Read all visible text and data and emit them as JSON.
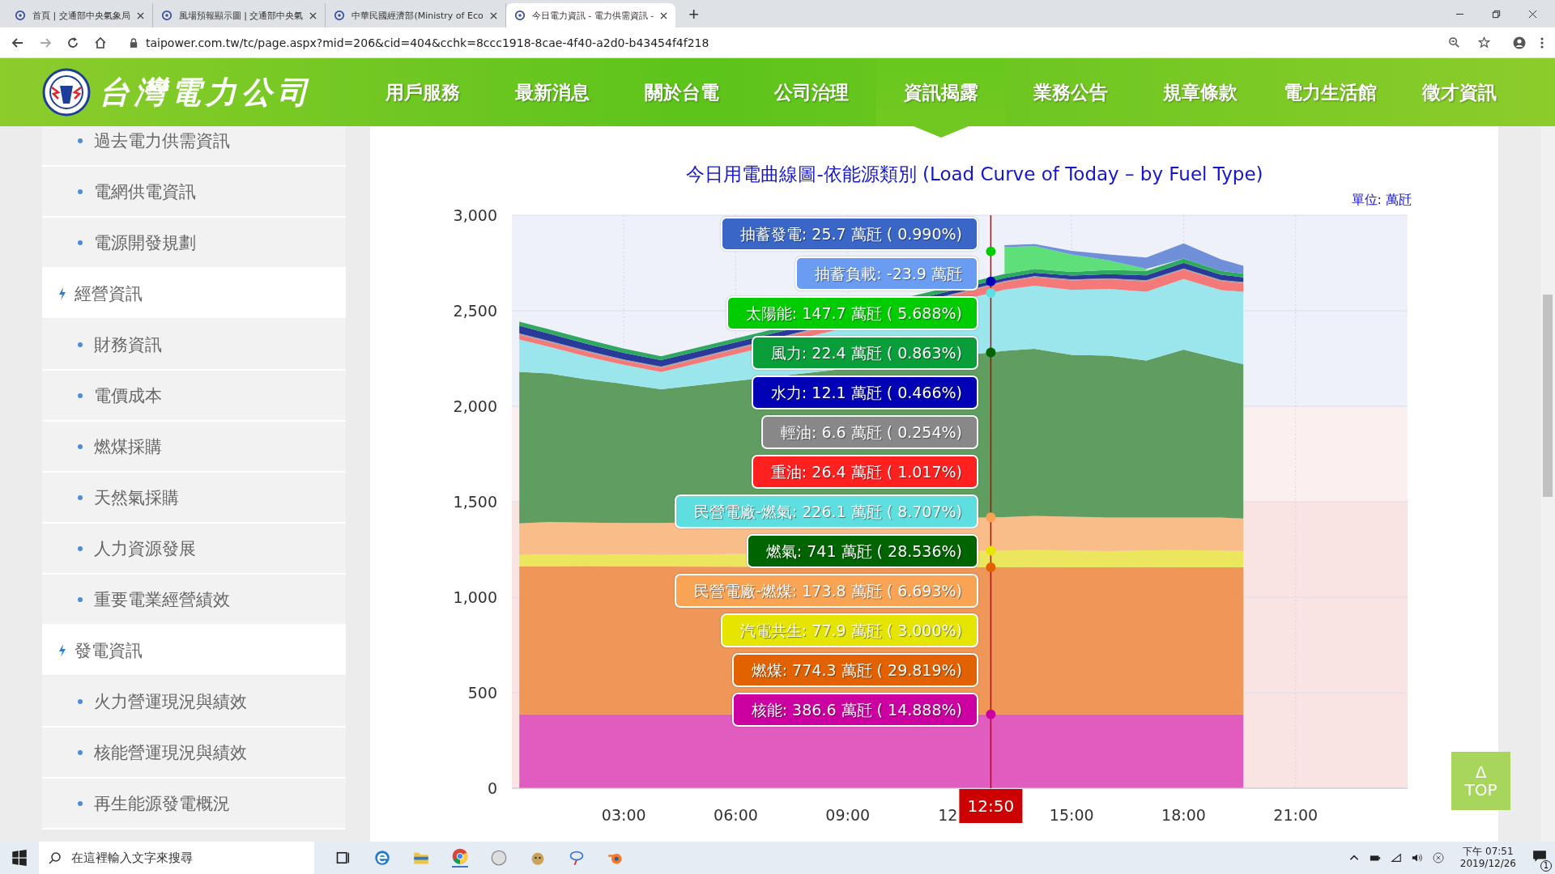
{
  "browser": {
    "tabs": [
      {
        "title": "首頁 | 交通部中央氣象局",
        "selected": false
      },
      {
        "title": "風場預報顯示圖 | 交通部中央氣",
        "selected": false
      },
      {
        "title": "中華民國經濟部(Ministry of Eco",
        "selected": false
      },
      {
        "title": "今日電力資訊 - 電力供需資訊 -",
        "selected": true
      }
    ],
    "new_tab": "+",
    "url": "taipower.com.tw/tc/page.aspx?mid=206&cid=404&cchk=8ccc1918-8cae-4f40-a2d0-b43454f4f218"
  },
  "header": {
    "logo_text": "台灣電力公司",
    "nav": [
      {
        "label": "用戶服務",
        "selected": false
      },
      {
        "label": "最新消息",
        "selected": false
      },
      {
        "label": "關於台電",
        "selected": false
      },
      {
        "label": "公司治理",
        "selected": false
      },
      {
        "label": "資訊揭露",
        "selected": true
      },
      {
        "label": "業務公告",
        "selected": false
      },
      {
        "label": "規章條款",
        "selected": false
      },
      {
        "label": "電力生活館",
        "selected": false
      },
      {
        "label": "徵才資訊",
        "selected": false
      }
    ]
  },
  "sidebar": {
    "items": [
      {
        "label": "過去電力供需資訊",
        "kind": "link"
      },
      {
        "label": "電網供電資訊",
        "kind": "link"
      },
      {
        "label": "電源開發規劃",
        "kind": "link"
      },
      {
        "label": "經營資訊",
        "kind": "section"
      },
      {
        "label": "財務資訊",
        "kind": "link"
      },
      {
        "label": "電價成本",
        "kind": "link"
      },
      {
        "label": "燃煤採購",
        "kind": "link"
      },
      {
        "label": "天然氣採購",
        "kind": "link"
      },
      {
        "label": "人力資源發展",
        "kind": "link"
      },
      {
        "label": "重要電業經營績效",
        "kind": "link"
      },
      {
        "label": "發電資訊",
        "kind": "section"
      },
      {
        "label": "火力營運現況與績效",
        "kind": "link"
      },
      {
        "label": "核能營運現況與績效",
        "kind": "link"
      },
      {
        "label": "再生能源發電概況",
        "kind": "link"
      }
    ]
  },
  "main": {
    "unit": "單位: 萬瓩",
    "chart_data": {
      "type": "area",
      "stacked": true,
      "grid": true,
      "title": "今日用電曲線圖-依能源類別 (Load Curve of Today – by Fuel Type)",
      "x": [
        0.2,
        1,
        2,
        3,
        4,
        13.2,
        14,
        15,
        16,
        17,
        18,
        19,
        19.6
      ],
      "xlim": [
        0,
        24
      ],
      "ylim": [
        0,
        3000
      ],
      "xticks": [
        {
          "value": 3,
          "label": "03:00"
        },
        {
          "value": 6,
          "label": "06:00"
        },
        {
          "value": 9,
          "label": "09:00"
        },
        {
          "value": 15,
          "label": "15:00"
        },
        {
          "value": 18,
          "label": "18:00"
        },
        {
          "value": 21,
          "label": "21:00"
        }
      ],
      "yticks": [
        {
          "value": 0,
          "label": "0"
        },
        {
          "value": 500,
          "label": "500"
        },
        {
          "value": 1000,
          "label": "1,000"
        },
        {
          "value": 1500,
          "label": "1,500"
        },
        {
          "value": 2000,
          "label": "2,000"
        },
        {
          "value": 2500,
          "label": "2,500"
        },
        {
          "value": 3000,
          "label": "3,000"
        }
      ],
      "bands": [
        {
          "axis": "y",
          "from": 2000,
          "to": 3000,
          "color": "#eef0fa"
        },
        {
          "axis": "y",
          "from": 1500,
          "to": 2000,
          "color": "#fcefef"
        },
        {
          "axis": "y",
          "from": 0,
          "to": 1500,
          "color": "#f9e3e3"
        }
      ],
      "ref_lines": [
        {
          "axis": "x",
          "value": 12.8333,
          "color": "#cc0000"
        }
      ],
      "series": [
        {
          "name": "核能",
          "color": "#e05cbf",
          "values": [
            387,
            387,
            387,
            387,
            387,
            387,
            387,
            387,
            387,
            387,
            387,
            387,
            387
          ]
        },
        {
          "name": "燃煤",
          "color": "#ef9659",
          "values": [
            775,
            775,
            776,
            775,
            774,
            770,
            771,
            770,
            770,
            771,
            770,
            770,
            770
          ]
        },
        {
          "name": "汽電共生",
          "color": "#ece55e",
          "values": [
            60,
            62,
            60,
            62,
            60,
            88,
            90,
            88,
            85,
            88,
            90,
            88,
            85
          ]
        },
        {
          "name": "民營電廠-燃煤",
          "color": "#f9bd8a",
          "values": [
            165,
            170,
            168,
            165,
            168,
            175,
            178,
            176,
            175,
            172,
            170,
            172,
            170
          ]
        },
        {
          "name": "燃氣",
          "color": "#5f9e60",
          "values": [
            793,
            778,
            750,
            728,
            700,
            870,
            875,
            848,
            848,
            821,
            879,
            831,
            808
          ]
        },
        {
          "name": "民營電廠-燃氣",
          "color": "#9be6ec",
          "values": [
            170,
            140,
            120,
            100,
            90,
            320,
            330,
            340,
            350,
            360,
            370,
            360,
            380
          ]
        },
        {
          "name": "重油",
          "color": "#f47a7a",
          "values": [
            25,
            24,
            24,
            22,
            22,
            40,
            45,
            50,
            50,
            55,
            50,
            48,
            45
          ]
        },
        {
          "name": "輕油",
          "color": "#a0a0a0",
          "values": [
            6,
            6,
            6,
            6,
            6,
            6,
            5,
            5,
            5,
            6,
            5,
            5,
            5
          ]
        },
        {
          "name": "水力",
          "color": "#2a3a9a",
          "values": [
            40,
            38,
            36,
            35,
            35,
            15,
            18,
            20,
            22,
            25,
            30,
            28,
            25
          ]
        },
        {
          "name": "風力",
          "color": "#2fa860",
          "values": [
            22,
            22,
            24,
            22,
            20,
            22,
            20,
            20,
            22,
            24,
            22,
            20,
            20
          ]
        },
        {
          "name": "太陽能",
          "color": "#5fdf7a",
          "values": [
            null,
            null,
            null,
            null,
            null,
            140,
            120,
            90,
            50,
            10,
            null,
            null,
            null
          ]
        },
        {
          "name": "抽蓄發電",
          "color": "#6f8fd8",
          "values": [
            null,
            null,
            null,
            null,
            null,
            10,
            10,
            20,
            30,
            60,
            80,
            60,
            40
          ]
        }
      ]
    },
    "cursor_time": "12:50",
    "covered_tick_text": "12",
    "tooltip": {
      "items": [
        {
          "kind": "series",
          "reading": ": 25.7 萬瓩 ( 0.990%)",
          "color": "#3a66c8"
        },
        {
          "kind": "extra",
          "label": "抽蓄負載",
          "reading": ": -23.9 萬瓩",
          "color": "#6a9cf2"
        },
        {
          "kind": "series",
          "reading": ": 147.7 萬瓩 ( 5.688%)",
          "color": "#00cc00"
        },
        {
          "kind": "series",
          "reading": ": 22.4 萬瓩 ( 0.863%)",
          "color": "#0a9e3a"
        },
        {
          "kind": "series",
          "reading": ": 12.1 萬瓩 ( 0.466%)",
          "color": "#0000b4"
        },
        {
          "kind": "series",
          "reading": ": 6.6 萬瓩 ( 0.254%)",
          "color": "#888888"
        },
        {
          "kind": "series",
          "reading": ": 26.4 萬瓩 ( 1.017%)",
          "color": "#ff2020"
        },
        {
          "kind": "series",
          "reading": ": 226.1 萬瓩 ( 8.707%)",
          "color": "#5edede"
        },
        {
          "kind": "series",
          "reading": ": 741 萬瓩 ( 28.536%)",
          "color": "#006400"
        },
        {
          "kind": "series",
          "reading": ": 173.8 萬瓩 ( 6.693%)",
          "color": "#f9a455"
        },
        {
          "kind": "series",
          "reading": ": 77.9 萬瓩 ( 3.000%)",
          "color": "#e5e500"
        },
        {
          "kind": "series",
          "reading": ": 774.3 萬瓩 ( 29.819%)",
          "color": "#e26100"
        },
        {
          "kind": "series",
          "reading": ": 386.6 萬瓩 ( 14.888%)",
          "color": "#cc00a0"
        }
      ]
    },
    "top_button": {
      "icon": "Δ",
      "label": "TOP"
    }
  },
  "taskbar": {
    "search_placeholder": "在這裡輸入文字來搜尋",
    "time": "下午 07:51",
    "date": "2019/12/26",
    "notification_count": "1"
  }
}
